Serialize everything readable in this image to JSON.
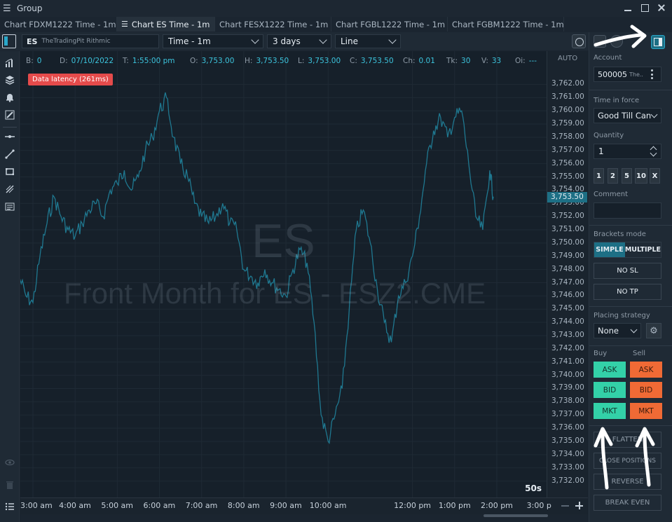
{
  "window": {
    "title": "Group",
    "menu_icon": "hamburger-icon",
    "controls": [
      "minimize-icon",
      "maximize-icon",
      "close-icon"
    ]
  },
  "tabs": [
    {
      "label": "Chart FDXM1222 Time - 1m",
      "active": false
    },
    {
      "label": "Chart ES Time - 1m",
      "active": true
    },
    {
      "label": "Chart FESX1222 Time - 1m",
      "active": false
    },
    {
      "label": "Chart FGBL1222 Time - 1m",
      "active": false
    },
    {
      "label": "Chart FGBM1222 Time - 1m",
      "active": false
    }
  ],
  "toolbar": {
    "symbol": "ES",
    "connection": "TheTradingPit Rithmic",
    "aggregation": "Time - 1m",
    "range": "3 days",
    "chart_style": "Line"
  },
  "info_bar": [
    {
      "key": "B:",
      "value": "0"
    },
    {
      "key": "D:",
      "value": "07/10/2022"
    },
    {
      "key": "T:",
      "value": "1:55:00 pm"
    },
    {
      "key": "O:",
      "value": "3,753.00"
    },
    {
      "key": "H:",
      "value": "3,753.50"
    },
    {
      "key": "L:",
      "value": "3,753.00"
    },
    {
      "key": "C:",
      "value": "3,753.50"
    },
    {
      "key": "Ch:",
      "value": "0.01"
    },
    {
      "key": "Tk:",
      "value": "30"
    },
    {
      "key": "V:",
      "value": "33"
    },
    {
      "key": "Oi:",
      "value": "---"
    }
  ],
  "latency_badge": "Data latency (261ms)",
  "watermark": {
    "symbol": "ES",
    "description": "Front Month for ES - ESZ2.CME"
  },
  "countdown": "50s",
  "price_axis": {
    "mode": "AUTO",
    "last_price": "3,753.50",
    "ticks": [
      "3,762.00",
      "3,761.00",
      "3,760.00",
      "3,759.00",
      "3,758.00",
      "3,757.00",
      "3,756.00",
      "3,755.00",
      "3,754.00",
      "3,753.00",
      "3,752.00",
      "3,751.00",
      "3,750.00",
      "3,749.00",
      "3,748.00",
      "3,747.00",
      "3,746.00",
      "3,745.00",
      "3,744.00",
      "3,743.00",
      "3,742.00",
      "3,741.00",
      "3,740.00",
      "3,739.00",
      "3,738.00",
      "3,737.00",
      "3,736.00",
      "3,735.00",
      "3,734.00",
      "3,733.00",
      "3,732.00"
    ]
  },
  "time_axis": {
    "ticks": [
      "3:00 am",
      "4:00 am",
      "5:00 am",
      "6:00 am",
      "7:00 am",
      "8:00 am",
      "9:00 am",
      "10:00 am",
      "12:00 pm",
      "1:00 pm",
      "2:00 pm",
      "3:00 p"
    ]
  },
  "chart_data": {
    "type": "line",
    "xlabel": "",
    "ylabel": "",
    "ylim": [
      3731.5,
      3762.5
    ],
    "x_range": [
      "2:40 am",
      "3:08 pm"
    ],
    "grid": true,
    "line_color": "#1f7890",
    "series": [
      {
        "x": [
          "2:40 am",
          "2:50 am",
          "3:00 am",
          "3:10 am",
          "3:20 am",
          "3:30 am",
          "3:40 am",
          "3:50 am",
          "4:00 am",
          "4:10 am",
          "4:20 am",
          "4:30 am",
          "4:40 am",
          "4:50 am",
          "5:00 am",
          "5:10 am",
          "5:20 am",
          "5:30 am",
          "5:40 am",
          "5:50 am",
          "6:00 am",
          "6:10 am",
          "6:20 am",
          "6:30 am",
          "6:40 am",
          "6:50 am",
          "7:00 am",
          "7:10 am",
          "7:20 am",
          "7:30 am",
          "7:40 am",
          "7:50 am",
          "8:00 am",
          "8:10 am",
          "8:20 am",
          "8:30 am",
          "8:40 am",
          "8:50 am",
          "9:00 am",
          "9:10 am",
          "9:20 am",
          "9:30 am",
          "9:40 am",
          "9:50 am",
          "10:00 am",
          "10:10 am",
          "10:20 am",
          "10:30 am",
          "10:40 am",
          "10:50 am",
          "11:00 am",
          "11:10 am",
          "11:20 am",
          "11:30 am",
          "11:40 am",
          "11:50 am",
          "12:00 pm",
          "12:10 pm",
          "12:20 pm",
          "12:30 pm",
          "12:40 pm",
          "12:50 pm",
          "1:00 pm",
          "1:10 pm",
          "1:20 pm",
          "1:30 pm",
          "1:40 pm",
          "1:50 pm",
          "1:55 pm"
        ],
        "y": [
          3747.5,
          3746.0,
          3745.5,
          3749.0,
          3751.5,
          3753.5,
          3752.0,
          3751.0,
          3750.5,
          3751.5,
          3752.5,
          3753.0,
          3752.0,
          3754.0,
          3754.5,
          3755.5,
          3754.0,
          3755.0,
          3757.0,
          3758.0,
          3760.0,
          3761.0,
          3758.0,
          3756.0,
          3755.0,
          3753.0,
          3752.0,
          3751.5,
          3752.0,
          3753.0,
          3751.5,
          3751.0,
          3748.0,
          3747.5,
          3747.0,
          3748.0,
          3747.0,
          3746.5,
          3746.0,
          3748.0,
          3749.5,
          3748.5,
          3744.0,
          3737.0,
          3735.0,
          3737.0,
          3739.0,
          3745.0,
          3751.0,
          3752.5,
          3750.0,
          3746.5,
          3744.0,
          3742.5,
          3746.0,
          3747.0,
          3749.0,
          3752.0,
          3756.0,
          3758.5,
          3759.5,
          3758.0,
          3759.5,
          3760.0,
          3756.0,
          3752.0,
          3751.0,
          3755.5,
          3753.5
        ]
      }
    ]
  },
  "order_panel": {
    "account_label": "Account",
    "account_value": "500005",
    "account_suffix": "The..",
    "tif_label": "Time in force",
    "tif_value": "Good Till Can",
    "quantity_label": "Quantity",
    "quantity_value": "1",
    "quick_qty": [
      "1",
      "2",
      "5",
      "10",
      "X"
    ],
    "comment_label": "Comment",
    "brackets_label": "Brackets mode",
    "brackets_simple": "SIMPLE",
    "brackets_multiple": "MULTIPLE",
    "no_sl": "NO SL",
    "no_tp": "NO TP",
    "placing_label": "Placing strategy",
    "placing_value": "None",
    "buy_label": "Buy",
    "sell_label": "Sell",
    "buy_ask": "ASK",
    "buy_bid": "BID",
    "buy_mkt": "MKT",
    "sell_ask": "ASK",
    "sell_bid": "BID",
    "sell_mkt": "MKT",
    "flatten": "FLATTEN",
    "close_positions": "CLOSE POSITIONS",
    "reverse": "REVERSE",
    "break_even": "BREAK EVEN",
    "buy_color": "#33d1a8",
    "sell_color": "#f06a35"
  }
}
